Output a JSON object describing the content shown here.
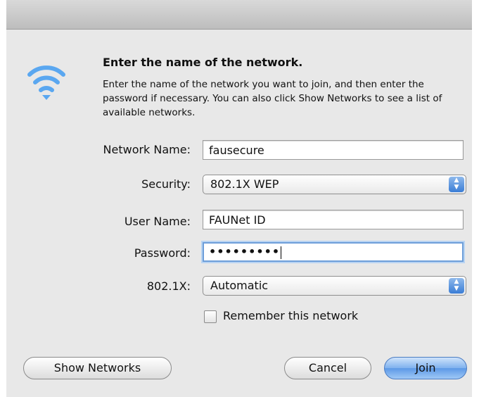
{
  "dialog": {
    "heading": "Enter the name of the network.",
    "description": "Enter the name of the network you want to join, and then enter the password if necessary. You can also click Show Networks to see a list of available networks.",
    "icon": "wifi-icon"
  },
  "form": {
    "network_name_label": "Network Name:",
    "network_name_value": "fausecure",
    "security_label": "Security:",
    "security_value": "802.1X WEP",
    "user_name_label": "User Name:",
    "user_name_value": "FAUNet ID",
    "password_label": "Password:",
    "password_value": "•••••••••",
    "eap_label": "802.1X:",
    "eap_value": "Automatic",
    "remember_label": "Remember this network",
    "remember_checked": false
  },
  "buttons": {
    "show_networks": "Show Networks",
    "cancel": "Cancel",
    "join": "Join"
  },
  "colors": {
    "wifi": "#5aa7f0",
    "default_button": "#5d99e6",
    "focus_ring": "#6d9ed9"
  }
}
